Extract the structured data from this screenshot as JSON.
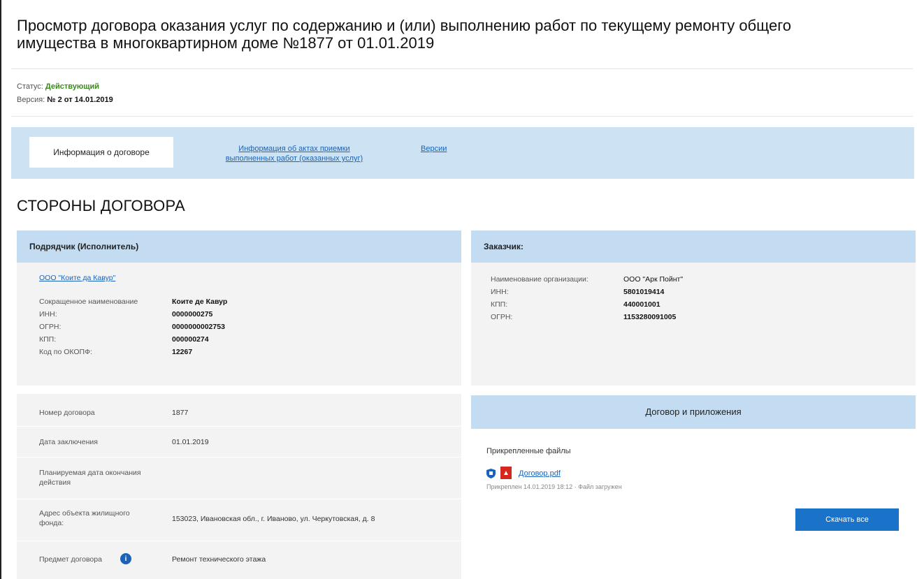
{
  "page": {
    "title_line1": "Просмотр договора оказания услуг по содержанию и (или) выполнению работ по текущему ремонту общего",
    "title_line2": "имущества в многоквартирном доме №1877 от 01.01.2019"
  },
  "meta": {
    "status_label": "Статус:",
    "status_value": "Действующий",
    "version_label": "Версия:",
    "version_value": "№ 2 от 14.01.2019"
  },
  "tabs": [
    {
      "label": "Информация о договоре"
    },
    {
      "label_line1": "Информация об актах приемки",
      "label_line2": "выполненных работ (оказанных услуг)"
    },
    {
      "label": "Версии"
    }
  ],
  "section_title": "СТОРОНЫ ДОГОВОРА",
  "contractor": {
    "heading": "Подрядчик (Исполнитель)",
    "org_link": "ООО \"Коите да Кавур\"",
    "fields": [
      {
        "label": "Сокращенное наименование",
        "value": "Коите де Кавур"
      },
      {
        "label": "ИНН:",
        "value": "0000000275"
      },
      {
        "label": "ОГРН:",
        "value": "0000000002753"
      },
      {
        "label": "КПП:",
        "value": "000000274"
      },
      {
        "label": "Код по ОКОПФ:",
        "value": "12267"
      }
    ]
  },
  "customer": {
    "heading": "Заказчик:",
    "fields": [
      {
        "label": "Наименование организации:",
        "value": "ООО \"Арк Пойнт\""
      },
      {
        "label": "ИНН:",
        "value": "5801019414"
      },
      {
        "label": "КПП:",
        "value": "440001001"
      },
      {
        "label": "ОГРН:",
        "value": "1153280091005"
      }
    ]
  },
  "contract": {
    "rows": [
      {
        "label": "Номер договора",
        "value": "1877"
      },
      {
        "label": "Дата заключения",
        "value": "01.01.2019"
      },
      {
        "label_line1": "Планируемая дата окончания",
        "label_line2": "действия",
        "value": ""
      },
      {
        "label_line1": "Адрес объекта жилищного",
        "label_line2": "фонда:",
        "value": "153023, Ивановская обл., г. Иваново, ул. Черкутовская, д. 8"
      },
      {
        "label": "Предмет договора",
        "value": "Ремонт технического этажа"
      }
    ]
  },
  "documents": {
    "heading": "Договор и приложения",
    "files_label": "Прикрепленные файлы",
    "file_name": "Договор.pdf",
    "file_note": "Прикреплен 14.01.2019 18:12 · Файл загружен",
    "download_button": "Скачать все"
  },
  "colors": {
    "accent": "#1a63b8",
    "status_green": "#3a8a1e",
    "tab_bar": "#cde3f3",
    "panel_head": "#c3dcf1",
    "button": "#1a73c8"
  }
}
